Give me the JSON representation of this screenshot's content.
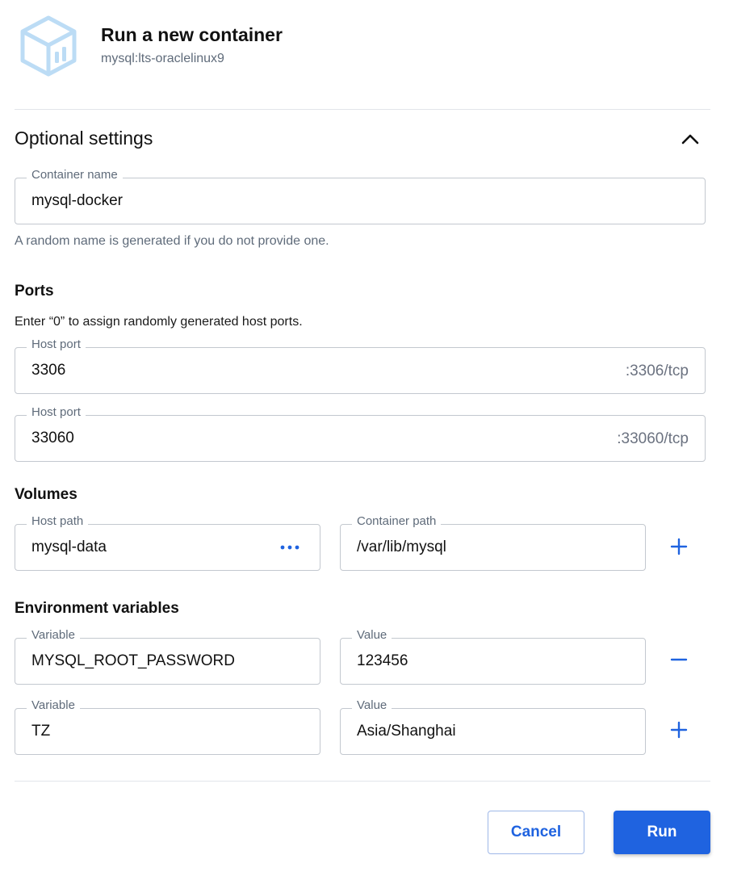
{
  "header": {
    "title": "Run a new container",
    "image": "mysql:lts-oraclelinux9",
    "logo_icon": "container-cube-icon"
  },
  "optional": {
    "title": "Optional settings",
    "toggle_icon": "chevron-up-icon",
    "container_name": {
      "label": "Container name",
      "value": "mysql-docker",
      "helper": "A random name is generated if you do not provide one."
    }
  },
  "ports": {
    "title": "Ports",
    "note": "Enter “0” to assign randomly generated host ports.",
    "items": [
      {
        "label": "Host port",
        "value": "3306",
        "container": ":3306/tcp"
      },
      {
        "label": "Host port",
        "value": "33060",
        "container": ":33060/tcp"
      }
    ]
  },
  "volumes": {
    "title": "Volumes",
    "host_label": "Host path",
    "host_value": "mysql-data",
    "container_label": "Container path",
    "container_value": "/var/lib/mysql",
    "browse_icon": "more-horizontal-icon",
    "add_icon": "plus-icon"
  },
  "env": {
    "title": "Environment variables",
    "rows": [
      {
        "var_label": "Variable",
        "var_value": "MYSQL_ROOT_PASSWORD",
        "val_label": "Value",
        "val_value": "123456",
        "action_icon": "minus-icon"
      },
      {
        "var_label": "Variable",
        "var_value": "TZ",
        "val_label": "Value",
        "val_value": "Asia/Shanghai",
        "action_icon": "plus-icon"
      }
    ]
  },
  "actions": {
    "cancel": "Cancel",
    "run": "Run"
  },
  "colors": {
    "accent": "#1f63e0",
    "logo": "#bcdcf5",
    "muted_text": "#5f6b7a"
  }
}
